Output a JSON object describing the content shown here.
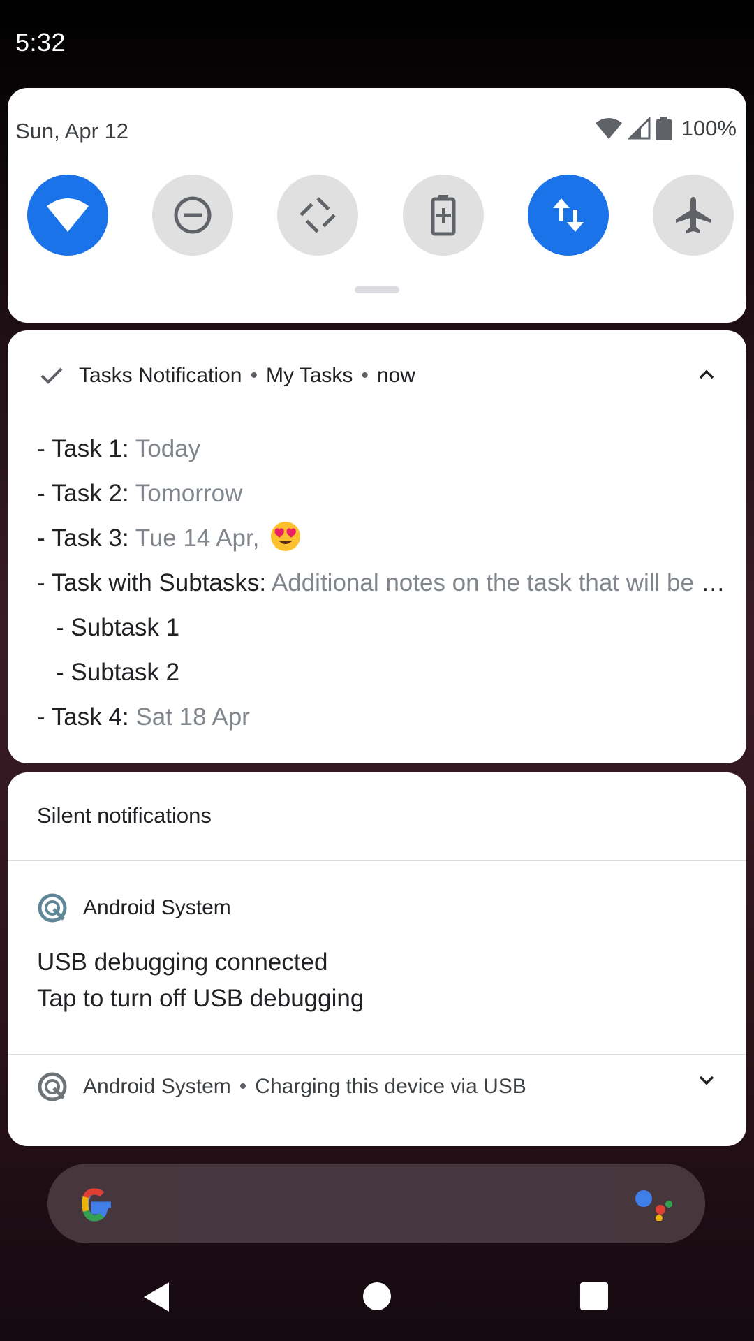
{
  "status_bar": {
    "time": "5:32"
  },
  "quick_settings": {
    "date": "Sun, Apr 12",
    "battery_percent": "100%",
    "tiles": [
      {
        "icon": "wifi-icon",
        "active": true
      },
      {
        "icon": "do-not-disturb-icon",
        "active": false
      },
      {
        "icon": "auto-rotate-icon",
        "active": false
      },
      {
        "icon": "battery-saver-icon",
        "active": false
      },
      {
        "icon": "mobile-data-icon",
        "active": true
      },
      {
        "icon": "airplane-mode-icon",
        "active": false
      }
    ]
  },
  "tasks_notification": {
    "app_name": "Tasks Notification",
    "separator": "•",
    "subtext": "My Tasks",
    "time": "now",
    "rows": [
      {
        "label": "- Task 1:",
        "detail": " Today"
      },
      {
        "label": "- Task 2:",
        "detail": " Tomorrow"
      },
      {
        "label": "- Task 3:",
        "detail": " Tue 14 Apr,"
      },
      {
        "label": "- Task with Subtasks:",
        "detail": " Additional notes on the task that will be shown"
      },
      {
        "label": "- Subtask 1",
        "detail": ""
      },
      {
        "label": "- Subtask 2",
        "detail": ""
      },
      {
        "label": "- Task 4:",
        "detail": " Sat 18 Apr"
      }
    ]
  },
  "silent_section": {
    "title": "Silent notifications",
    "usb_debugging": {
      "app_name": "Android System",
      "title": "USB debugging connected",
      "text": "Tap to turn off USB debugging"
    },
    "charging": {
      "app_name": "Android System",
      "separator": "•",
      "text": "Charging this device via USB"
    }
  },
  "colors": {
    "accent": "#1a73e8",
    "tile_off": "#e0e0e0",
    "secondary_text": "#80868b"
  }
}
